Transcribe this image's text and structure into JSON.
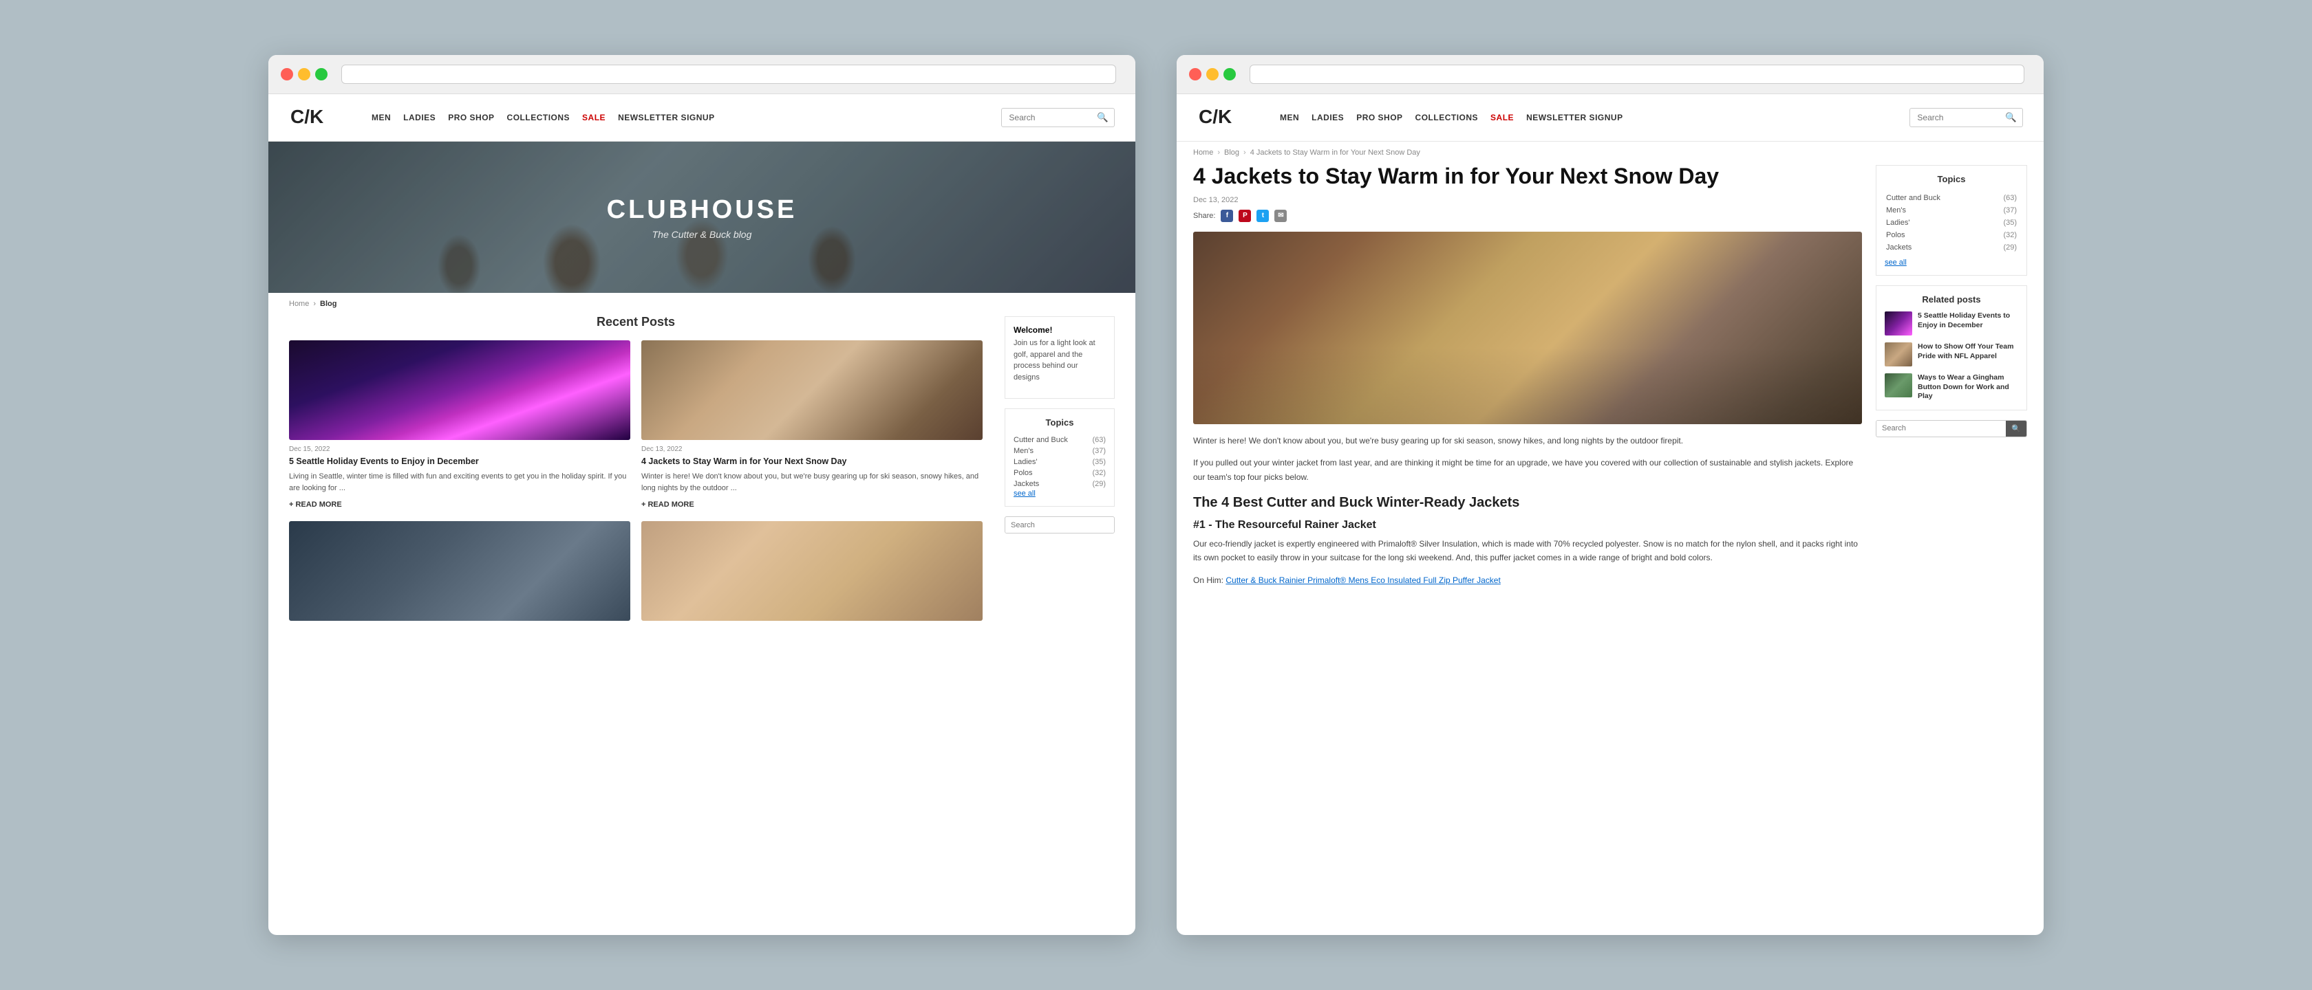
{
  "leftWindow": {
    "nav": {
      "items": [
        {
          "label": "MEN",
          "id": "men"
        },
        {
          "label": "LADIES",
          "id": "ladies"
        },
        {
          "label": "PRO SHOP",
          "id": "pro-shop"
        },
        {
          "label": "COLLECTIONS",
          "id": "collections"
        },
        {
          "label": "SALE",
          "id": "sale",
          "highlight": true
        },
        {
          "label": "NEWSLETTER SIGNUP",
          "id": "newsletter"
        }
      ],
      "search_placeholder": "Search"
    },
    "hero": {
      "title": "CLUBHOUSE",
      "subtitle": "The Cutter & Buck blog"
    },
    "breadcrumb": {
      "home": "Home",
      "current": "Blog"
    },
    "recentPosts": {
      "title": "Recent Posts",
      "posts": [
        {
          "date": "Dec 15, 2022",
          "title": "5 Seattle Holiday Events to Enjoy in December",
          "excerpt": "Living in Seattle, winter time is filled with fun and exciting events to get you in the holiday spirit. If you are looking for ...",
          "readMore": "+ READ MORE",
          "imageType": "fireworks"
        },
        {
          "date": "Dec 13, 2022",
          "title": "4 Jackets to Stay Warm in for Your Next Snow Day",
          "excerpt": "Winter is here! We don't know about you, but we're busy gearing up for ski season, snowy hikes, and long nights by the outdoor ...",
          "readMore": "+ READ MORE",
          "imageType": "group"
        },
        {
          "date": "",
          "title": "",
          "excerpt": "",
          "imageType": "store"
        },
        {
          "date": "",
          "title": "",
          "excerpt": "",
          "imageType": "woman"
        }
      ]
    },
    "sidebar": {
      "welcome": {
        "title": "Welcome!",
        "text": "Join us for a light look at golf, apparel and the process behind our designs"
      },
      "topics": {
        "title": "Topics",
        "items": [
          {
            "label": "Cutter and Buck",
            "count": "(63)"
          },
          {
            "label": "Men's",
            "count": "(37)"
          },
          {
            "label": "Ladies'",
            "count": "(35)"
          },
          {
            "label": "Polos",
            "count": "(32)"
          },
          {
            "label": "Jackets",
            "count": "(29)"
          }
        ],
        "seeAll": "see all"
      },
      "search_placeholder": "Search"
    }
  },
  "rightWindow": {
    "nav": {
      "items": [
        {
          "label": "MEN",
          "id": "men"
        },
        {
          "label": "LADIES",
          "id": "ladies"
        },
        {
          "label": "PRO SHOP",
          "id": "pro-shop"
        },
        {
          "label": "COLLECTIONS",
          "id": "collections"
        },
        {
          "label": "SALE",
          "id": "sale",
          "highlight": true
        },
        {
          "label": "NEWSLETTER SIGNUP",
          "id": "newsletter"
        }
      ],
      "search_placeholder": "Search"
    },
    "breadcrumb": {
      "home": "Home",
      "blog": "Blog",
      "current": "4 Jackets to Stay Warm in for Your Next Snow Day"
    },
    "article": {
      "title": "4 Jackets to Stay Warm in for Your Next Snow Day",
      "date": "Dec 13, 2022",
      "shareLabel": "Share:",
      "body1": "Winter is here! We don't know about you, but we're busy gearing up for ski season, snowy hikes, and long nights by the outdoor firepit.",
      "body2": "If you pulled out your winter jacket from last year, and are thinking it might be time for an upgrade, we have you covered with our collection of sustainable and stylish jackets. Explore our team's top four picks below.",
      "sectionTitle": "The 4 Best Cutter and Buck Winter-Ready Jackets",
      "subsection1": "#1 - The Resourceful Rainer Jacket",
      "body3": "Our eco-friendly jacket is expertly engineered with Primaloft® Silver Insulation, which is made with 70% recycled polyester. Snow is no match for the nylon shell, and it packs right into its own pocket to easily throw in your suitcase for the long ski weekend. And, this puffer jacket comes in a wide range of bright and bold colors.",
      "body4": "On Him:",
      "link1": "Cutter & Buck Rainier Primaloft® Mens Eco Insulated Full Zip Puffer Jacket"
    },
    "sidebar": {
      "topics": {
        "title": "Topics",
        "items": [
          {
            "label": "Cutter and Buck",
            "count": "(63)"
          },
          {
            "label": "Men's",
            "count": "(37)"
          },
          {
            "label": "Ladies'",
            "count": "(35)"
          },
          {
            "label": "Polos",
            "count": "(32)"
          },
          {
            "label": "Jackets",
            "count": "(29)"
          }
        ],
        "seeAll": "see all"
      },
      "relatedPosts": {
        "title": "Related posts",
        "items": [
          {
            "title": "5 Seattle Holiday Events to Enjoy in December",
            "imageType": "fireworks"
          },
          {
            "title": "How to Show Off Your Team Pride with NFL Apparel",
            "imageType": "group"
          },
          {
            "title": "Ways to Wear a Gingham Button Down for Work and Play",
            "imageType": "shirt"
          }
        ]
      },
      "search_placeholder": "Search"
    }
  }
}
